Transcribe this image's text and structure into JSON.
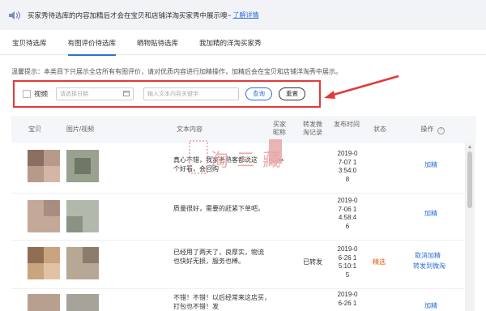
{
  "notice": {
    "text": "买家秀待选库的内容加精后才会在宝贝和店铺洋淘买家秀中展示噢~",
    "link": "了解详情"
  },
  "tabs": [
    {
      "label": "宝贝待选库",
      "active": false
    },
    {
      "label": "有图评价待选库",
      "active": true
    },
    {
      "label": "晒物贴待选库",
      "active": false
    },
    {
      "label": "我加精的洋淘买家秀",
      "active": false
    }
  ],
  "hint": "温馨提示：本类目下只展示全店所有有图评价，请对优质内容进行加精操作，加精后会在宝贝和店铺洋淘秀中展示。",
  "filter": {
    "video_label": "视频",
    "date_placeholder": "请选择日期",
    "keyword_placeholder": "输入文本内容关键字",
    "query_label": "查询",
    "reset_label": "重置"
  },
  "columns": {
    "item": "宝贝",
    "media": "图片/视频",
    "content": "文本内容",
    "nickname": "买家昵称",
    "forward": "转发微淘记录",
    "time": "发布时间",
    "status": "状态",
    "action": "操作"
  },
  "rows": [
    {
      "content": "真心不错，我家老熟客都说这个好看，会回购",
      "nickname": "**",
      "forward": "",
      "time_lines": [
        "2019-0",
        "7-07 1",
        "3:54:0",
        "8"
      ],
      "status": "",
      "actions": [
        "加精"
      ]
    },
    {
      "content": "质量很好，需要的赶紧下单吧。",
      "nickname": "",
      "forward": "",
      "time_lines": [
        "2019-0",
        "7-06 1",
        "4:58:4",
        "6"
      ],
      "status": "",
      "actions": [
        "加精"
      ]
    },
    {
      "content": "已经用了两天了，良厚实，物流也快好无损，服务也棒。",
      "nickname": "",
      "forward": "已转发",
      "time_lines": [
        "2019-0",
        "6-26 1",
        "5:10:1",
        "5"
      ],
      "status": "精选",
      "actions": [
        "取消加精",
        "转发到微淘"
      ]
    },
    {
      "content": "不错！不错！以后经常来这店买，打包也不错！发",
      "nickname": "",
      "forward": "",
      "time_lines": [
        "2019-0",
        "6-26 1"
      ],
      "status": "",
      "actions": [
        "加精"
      ]
    }
  ],
  "watermark": "淘 三 藏",
  "colors": {
    "accent": "#2f6fd6",
    "highlight_box": "#e23a3a",
    "featured": "#e85a0c"
  }
}
